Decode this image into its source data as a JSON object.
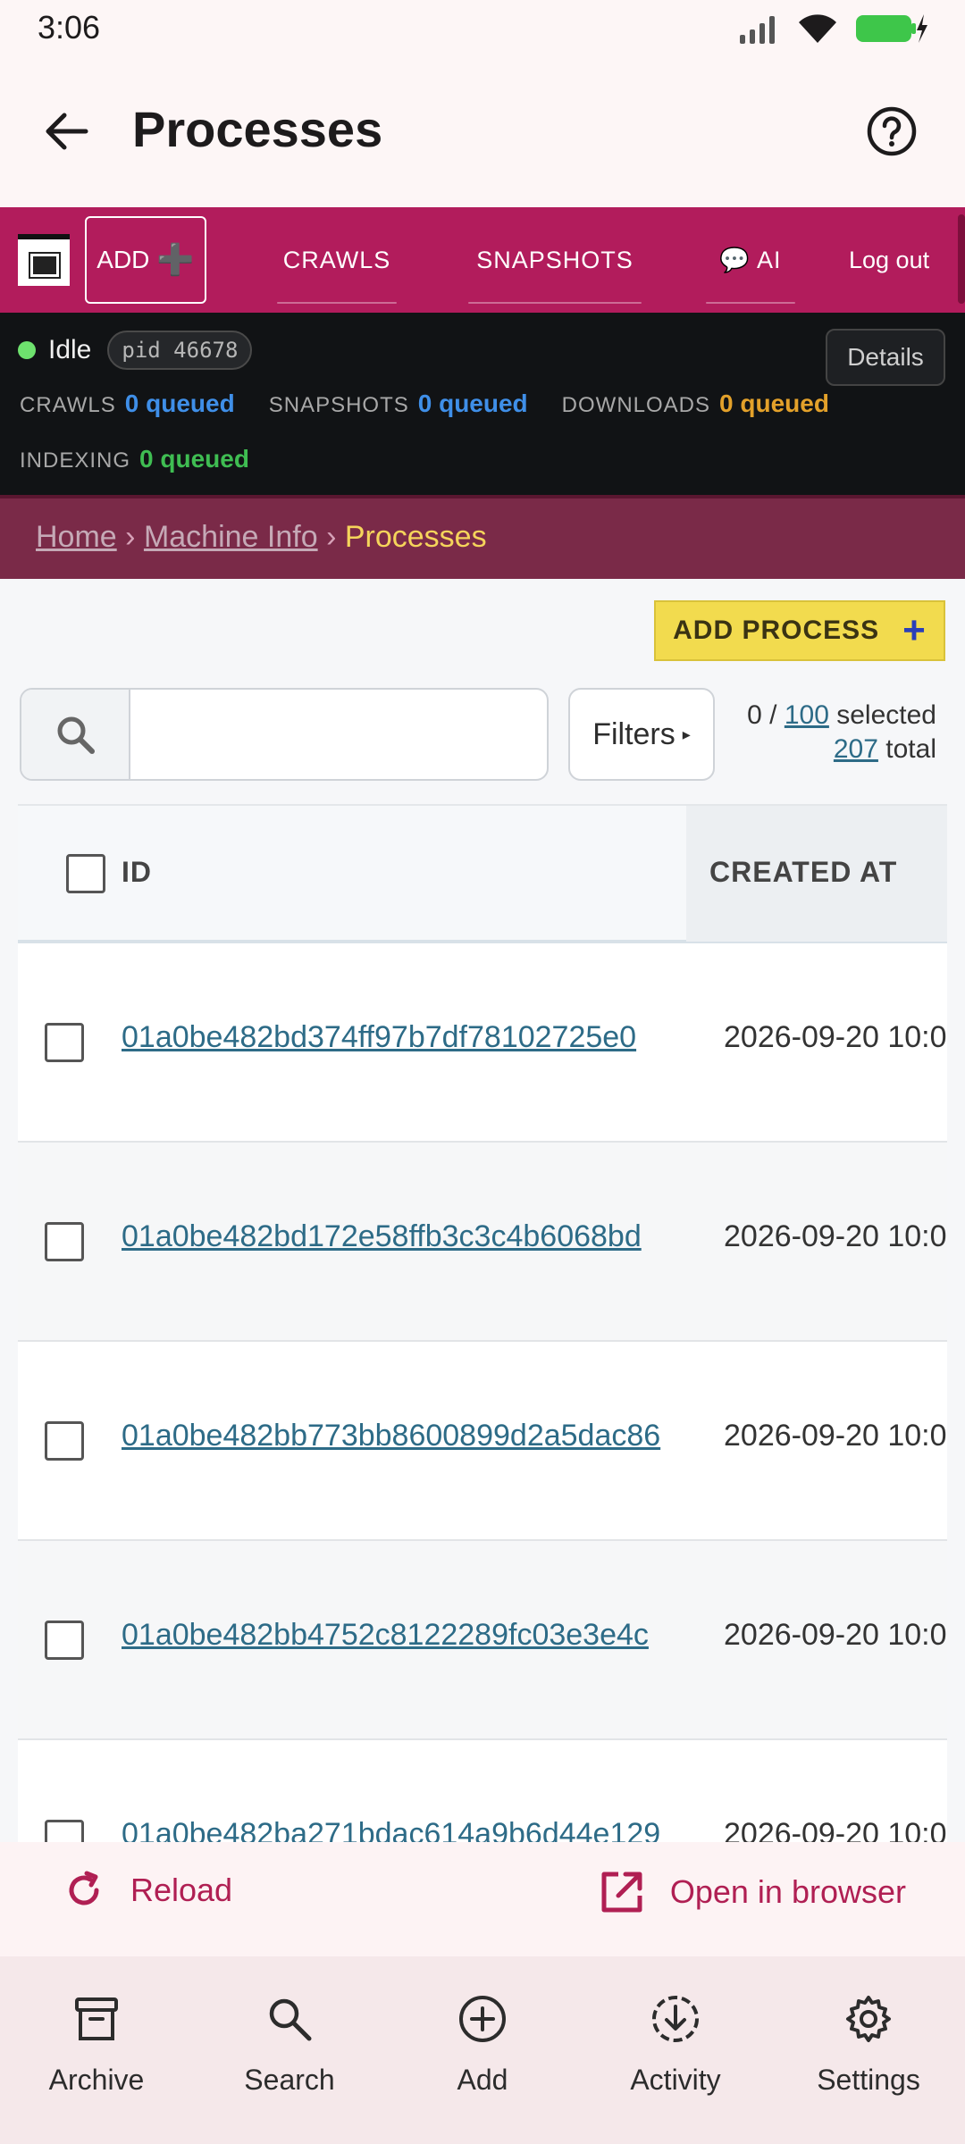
{
  "status_bar": {
    "time": "3:06"
  },
  "app_bar": {
    "title": "Processes"
  },
  "nav": {
    "add_label": "ADD",
    "items": [
      {
        "label": "CRAWLS"
      },
      {
        "label": "SNAPSHOTS"
      },
      {
        "label": "💬 AI"
      },
      {
        "label": "Log out"
      }
    ]
  },
  "status_panel": {
    "state": "Idle",
    "pid": "pid 46678",
    "details_label": "Details",
    "queues": [
      {
        "label": "CRAWLS",
        "value": "0 queued"
      },
      {
        "label": "SNAPSHOTS",
        "value": "0 queued"
      },
      {
        "label": "DOWNLOADS",
        "value": "0 queued"
      },
      {
        "label": "INDEXING",
        "value": "0 queued"
      }
    ]
  },
  "breadcrumb": {
    "home": "Home",
    "sep": "›",
    "machine_info": "Machine Info",
    "current": "Processes"
  },
  "toolbar": {
    "add_process_label": "ADD PROCESS",
    "search_placeholder": "",
    "filters_label": "Filters",
    "selected_count": "0",
    "page_size": "100",
    "selected_label": "selected",
    "total_count": "207",
    "total_label": "total"
  },
  "table": {
    "columns": [
      "ID",
      "CREATED AT"
    ],
    "rows": [
      {
        "id": "01a0be482bd374ff97b7df78102725e0",
        "created_at": "2026-09-20 10:0"
      },
      {
        "id": "01a0be482bd172e58ffb3c3c4b6068bd",
        "created_at": "2026-09-20 10:0"
      },
      {
        "id": "01a0be482bb773bb8600899d2a5dac86",
        "created_at": "2026-09-20 10:0"
      },
      {
        "id": "01a0be482bb4752c8122289fc03e3e4c",
        "created_at": "2026-09-20 10:0"
      },
      {
        "id": "01a0be482ba271bdac614a9b6d44e129",
        "created_at": "2026-09-20 10:0"
      }
    ]
  },
  "actions": {
    "reload": "Reload",
    "open_browser": "Open in browser"
  },
  "bottom_nav": [
    {
      "label": "Archive",
      "icon": "archive-icon"
    },
    {
      "label": "Search",
      "icon": "search-icon"
    },
    {
      "label": "Add",
      "icon": "add-circle-icon"
    },
    {
      "label": "Activity",
      "icon": "download-activity-icon"
    },
    {
      "label": "Settings",
      "icon": "gear-icon"
    }
  ],
  "colors": {
    "nav_bg": "#b21c5c",
    "panel_bg": "#111315",
    "breadcrumb_bg": "#7a2a48",
    "accent_yellow": "#f2db4e",
    "link": "#2d6b87",
    "action_red": "#b01f53"
  }
}
